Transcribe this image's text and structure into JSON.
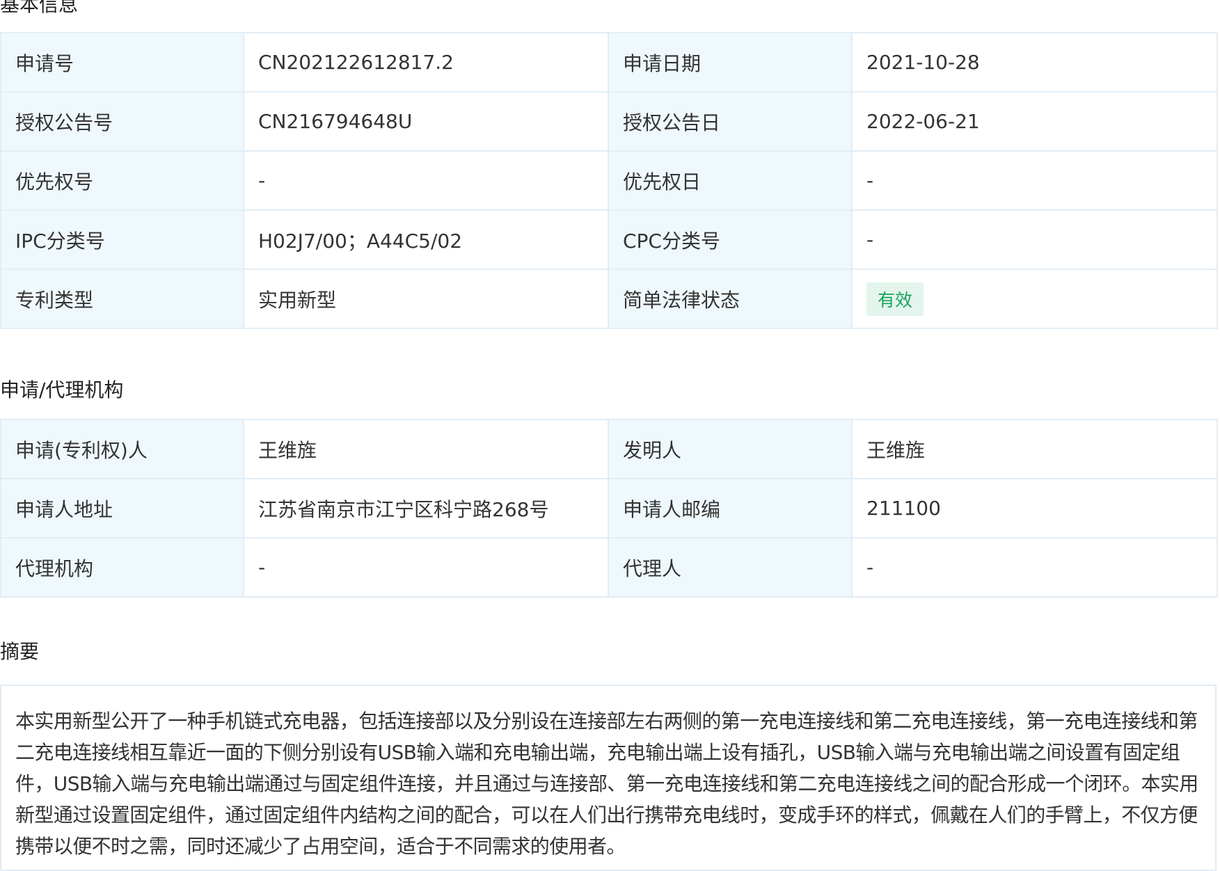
{
  "sections": {
    "basic": {
      "title": "基本信息",
      "rows": [
        [
          "申请号",
          "CN202122612817.2",
          "申请日期",
          "2021-10-28"
        ],
        [
          "授权公告号",
          "CN216794648U",
          "授权公告日",
          "2022-06-21"
        ],
        [
          "优先权号",
          "-",
          "优先权日",
          "-"
        ],
        [
          "IPC分类号",
          "H02J7/00；A44C5/02",
          "CPC分类号",
          "-"
        ],
        [
          "专利类型",
          "实用新型",
          "简单法律状态",
          "有效"
        ]
      ]
    },
    "agency": {
      "title": "申请/代理机构",
      "rows": [
        [
          "申请(专利权)人",
          "王维旌",
          "发明人",
          "王维旌"
        ],
        [
          "申请人地址",
          "江苏省南京市江宁区科宁路268号",
          "申请人邮编",
          "211100"
        ],
        [
          "代理机构",
          "-",
          "代理人",
          "-"
        ]
      ]
    },
    "abstract": {
      "title": "摘要",
      "text": "本实用新型公开了一种手机链式充电器，包括连接部以及分别设在连接部左右两侧的第一充电连接线和第二充电连接线，第一充电连接线和第二充电连接线相互靠近一面的下侧分别设有USB输入端和充电输出端，充电输出端上设有插孔，USB输入端与充电输出端之间设置有固定组件，USB输入端与充电输出端通过与固定组件连接，并且通过与连接部、第一充电连接线和第二充电连接线之间的配合形成一个闭环。本实用新型通过设置固定组件，通过固定组件内结构之间的配合，可以在人们出行携带充电线时，变成手环的样式，佩戴在人们的手臂上，不仅方便携带以便不时之需，同时还减少了占用空间，适合于不同需求的使用者。"
    }
  },
  "colors": {
    "label_bg": "#eff8fd",
    "border": "#e2edf5",
    "status_text": "#1aa260",
    "status_bg": "#e3f5ec"
  }
}
